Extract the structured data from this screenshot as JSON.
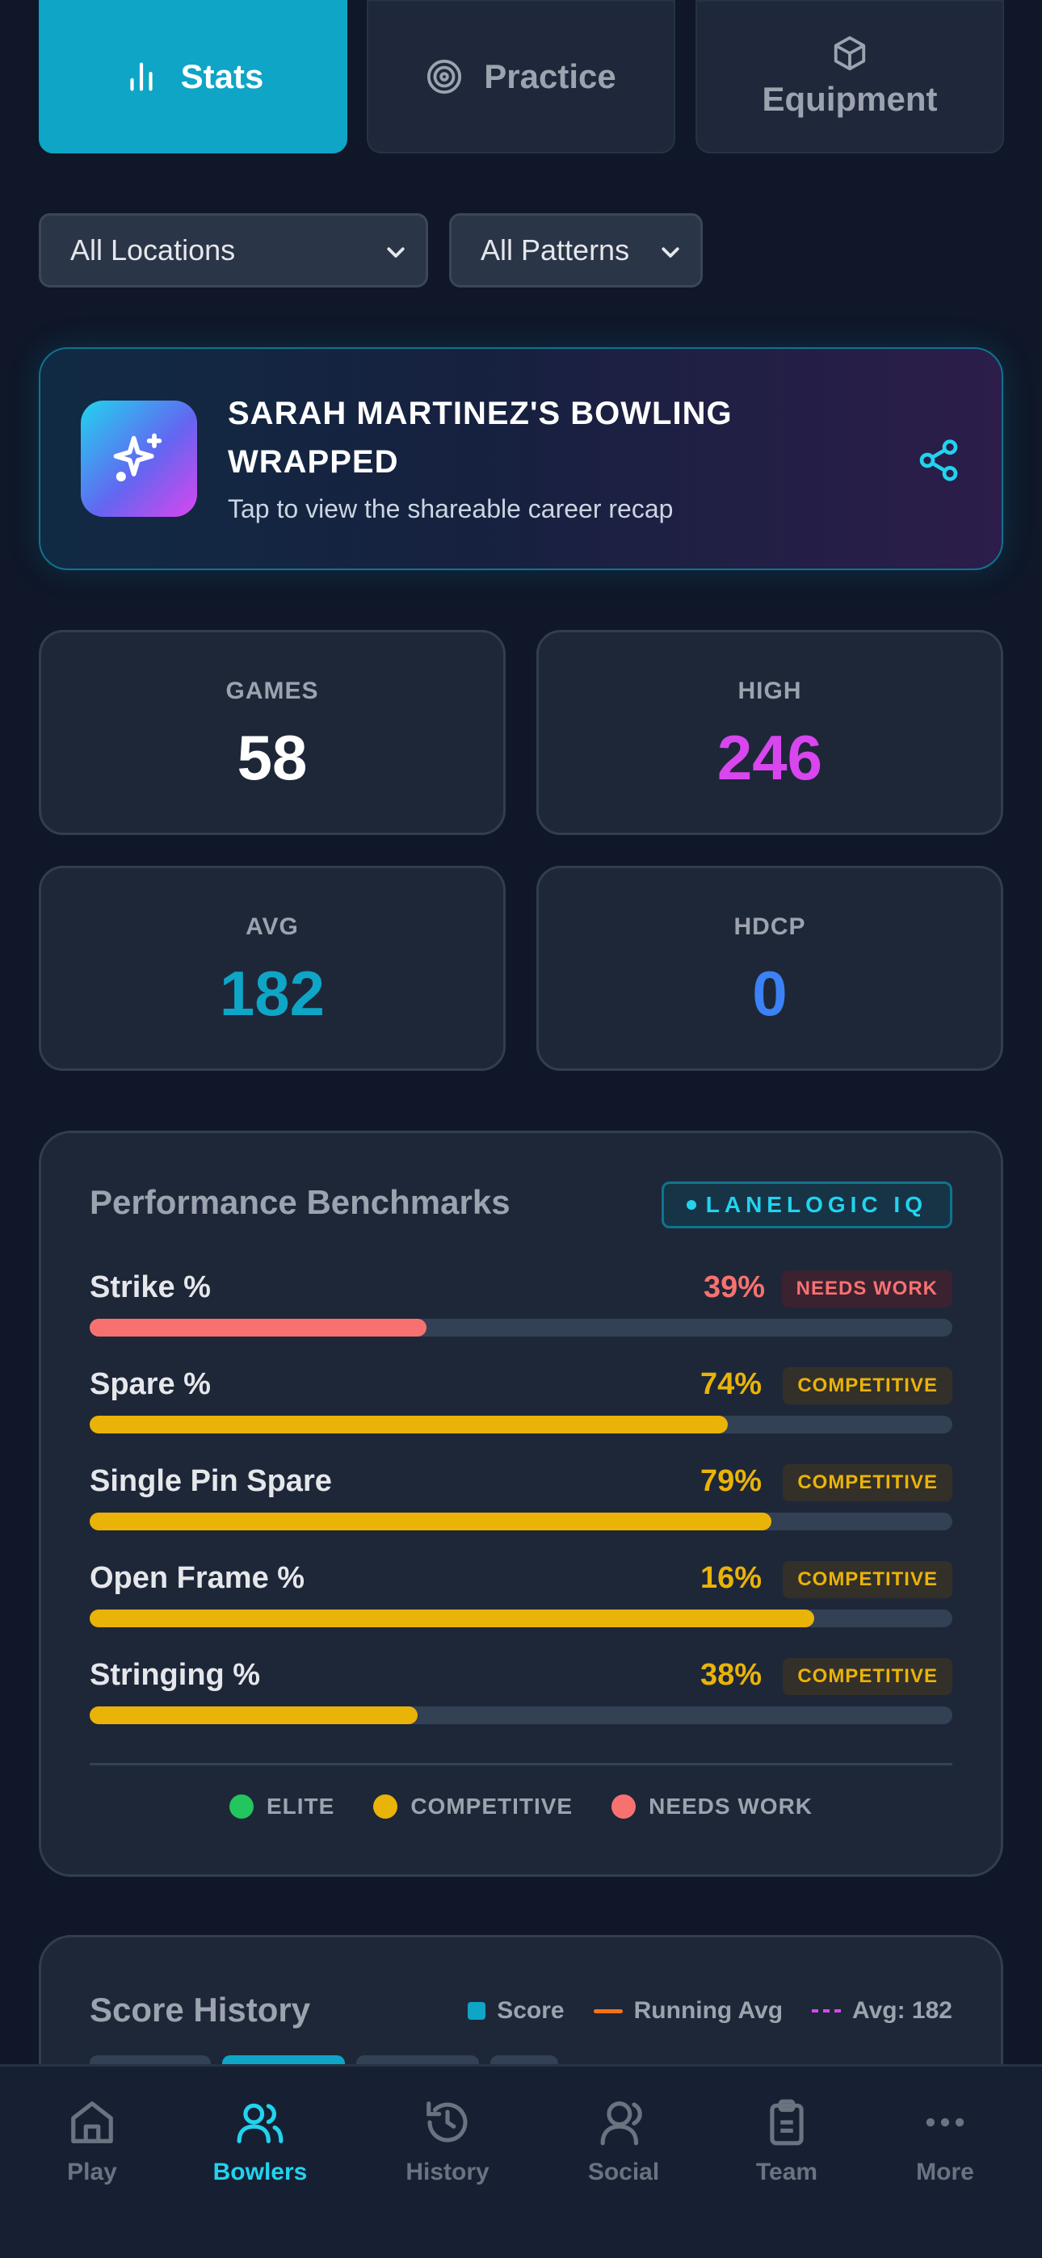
{
  "tabs": [
    {
      "label": "Stats",
      "icon": "bar-chart-icon",
      "active": true
    },
    {
      "label": "Practice",
      "icon": "target-icon",
      "active": false
    },
    {
      "label": "Equipment",
      "icon": "box-icon",
      "active": false
    }
  ],
  "filters": {
    "location": "All Locations",
    "pattern": "All Patterns"
  },
  "wrapped": {
    "title": "SARAH MARTINEZ'S BOWLING WRAPPED",
    "subtitle": "Tap to view the shareable career recap",
    "icon": "sparkle-icon",
    "share_icon": "share-icon"
  },
  "stats": {
    "games": {
      "label": "GAMES",
      "value": "58",
      "color": "#ffffff"
    },
    "high": {
      "label": "HIGH",
      "value": "246",
      "color": "#d946ef"
    },
    "avg": {
      "label": "AVG",
      "value": "182",
      "color": "#0ea5c6"
    },
    "hdcp": {
      "label": "HDCP",
      "value": "0",
      "color": "#3b82f6"
    }
  },
  "benchmarks": {
    "title": "Performance Benchmarks",
    "badge": "LANELOGIC IQ",
    "metrics": [
      {
        "name": "Strike %",
        "value": "39%",
        "level": 0.39,
        "status": "NEEDS WORK",
        "color": "#f87171"
      },
      {
        "name": "Spare %",
        "value": "74%",
        "level": 0.74,
        "status": "COMPETITIVE",
        "color": "#eab308"
      },
      {
        "name": "Single Pin Spare",
        "value": "79%",
        "level": 0.79,
        "status": "COMPETITIVE",
        "color": "#eab308"
      },
      {
        "name": "Open Frame %",
        "value": "16%",
        "level": 0.84,
        "status": "COMPETITIVE",
        "color": "#eab308"
      },
      {
        "name": "Stringing %",
        "value": "38%",
        "level": 0.38,
        "status": "COMPETITIVE",
        "color": "#eab308"
      }
    ],
    "legend": [
      {
        "label": "ELITE",
        "color": "#22c55e"
      },
      {
        "label": "COMPETITIVE",
        "color": "#eab308"
      },
      {
        "label": "NEEDS WORK",
        "color": "#f87171"
      }
    ]
  },
  "score_history": {
    "title": "Score History",
    "legend": [
      {
        "label": "Score",
        "color": "#0ea5c6"
      },
      {
        "label": "Running Avg",
        "color": "#f97316"
      },
      {
        "label": "Avg: 182",
        "color": "#d946ef"
      }
    ]
  },
  "nav": [
    {
      "label": "Play",
      "icon": "home-icon",
      "active": false
    },
    {
      "label": "Bowlers",
      "icon": "users-icon",
      "active": true
    },
    {
      "label": "History",
      "icon": "history-icon",
      "active": false
    },
    {
      "label": "Social",
      "icon": "social-icon",
      "active": false
    },
    {
      "label": "Team",
      "icon": "clipboard-icon",
      "active": false
    },
    {
      "label": "More",
      "icon": "more-icon",
      "active": false
    }
  ]
}
